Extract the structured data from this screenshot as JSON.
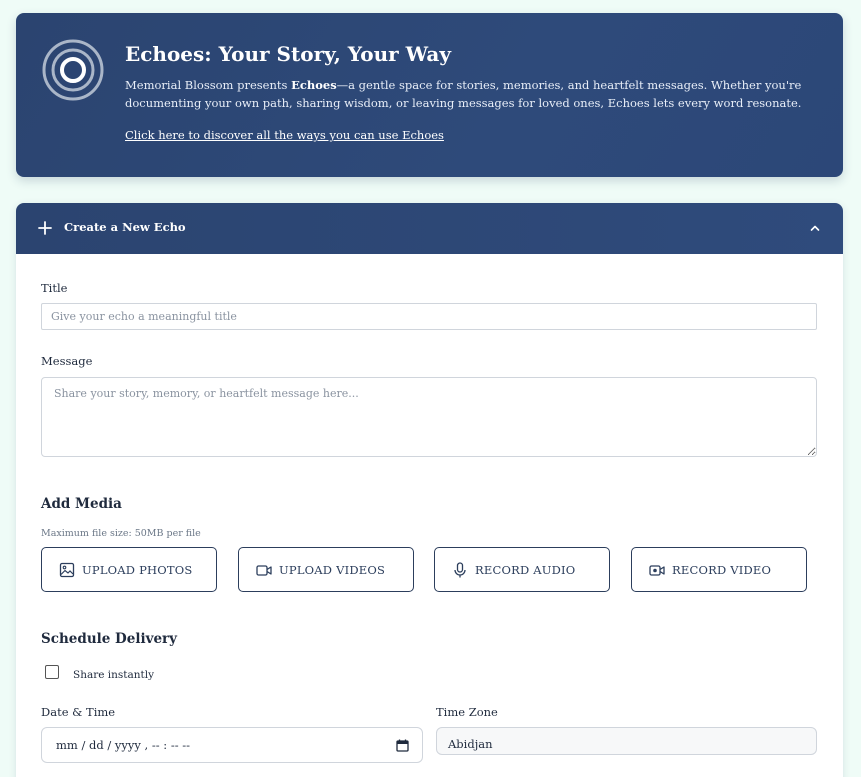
{
  "hero": {
    "title": "Echoes: Your Story, Your Way",
    "desc_prefix": "Memorial Blossom presents ",
    "desc_bold": "Echoes",
    "desc_suffix": "—a gentle space for stories, memories, and heartfelt messages. Whether you're documenting your own path, sharing wisdom, or leaving messages for loved ones, Echoes lets every word resonate.",
    "link": "Click here to discover all the ways you can use Echoes",
    "logo_icon": "concentric-circles-icon"
  },
  "card": {
    "header_title": "Create a New Echo",
    "header_icon": "plus-icon",
    "collapse_icon": "chevron-up-icon"
  },
  "form": {
    "title_label": "Title",
    "title_placeholder": "Give your echo a meaningful title",
    "message_label": "Message",
    "message_placeholder": "Share your story, memory, or heartfelt message here..."
  },
  "media": {
    "heading": "Add Media",
    "hint": "Maximum file size: 50MB per file",
    "buttons": [
      {
        "label": "UPLOAD PHOTOS",
        "icon": "image-icon"
      },
      {
        "label": "UPLOAD VIDEOS",
        "icon": "video-camera-icon"
      },
      {
        "label": "RECORD AUDIO",
        "icon": "microphone-icon"
      },
      {
        "label": "RECORD VIDEO",
        "icon": "record-video-icon"
      }
    ]
  },
  "schedule": {
    "heading": "Schedule Delivery",
    "share_instantly": "Share instantly",
    "share_instantly_checked": false,
    "datetime_label": "Date & Time",
    "datetime_value": "mm / dd / yyyy ,  -- : --   --",
    "timezone_label": "Time Zone",
    "timezone_value": "Abidjan"
  },
  "colors": {
    "page_bg": "#effcf7",
    "header_bg": "#2b4470",
    "button_border": "#2c3e5c"
  }
}
